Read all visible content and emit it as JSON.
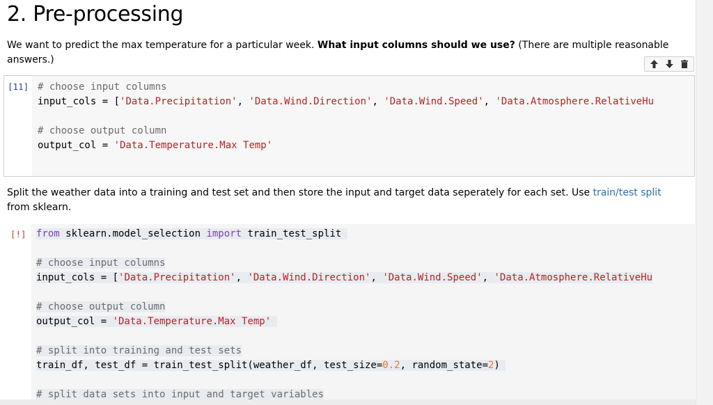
{
  "section_title": "2. Pre-processing",
  "md1": {
    "text_before": "We want to predict the max temperature for a particular week. ",
    "bold": "What input columns should we use?",
    "text_after": " (There are multiple reasonable answers.)"
  },
  "toolbar": {
    "move_up": "move-up",
    "move_down": "move-down",
    "delete": "delete"
  },
  "cell1": {
    "prompt": "[11]",
    "lines": [
      "# choose input columns",
      "input_cols = ['Data.Precipitation', 'Data.Wind.Direction', 'Data.Wind.Speed', 'Data.Atmosphere.RelativeHu",
      "",
      "# choose output column",
      "output_col = 'Data.Temperature.Max Temp'"
    ]
  },
  "md2": {
    "text_before": "Split the weather data into a training and test set and then store the input and target data seperately for each set. Use ",
    "link": "train/test split",
    "text_after": " from sklearn."
  },
  "cell2": {
    "prompt": "[!]",
    "lines": [
      "from sklearn.model_selection import train_test_split",
      "",
      "# choose input columns",
      "input_cols = ['Data.Precipitation', 'Data.Wind.Direction', 'Data.Wind.Speed', 'Data.Atmosphere.RelativeHu",
      "",
      "# choose output column",
      "output_col = 'Data.Temperature.Max Temp'",
      "",
      "# split into training and test sets",
      "train_df, test_df = train_test_split(weather_df, test_size=0.2, random_state=2)",
      "",
      "# split data sets into input and target variables"
    ]
  }
}
